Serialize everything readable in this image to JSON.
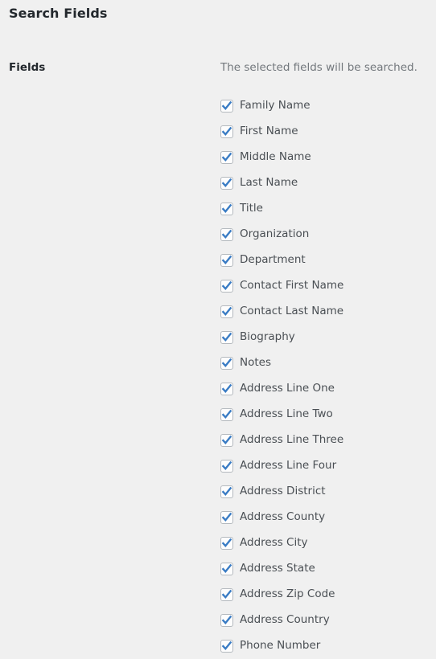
{
  "page": {
    "title": "Search Fields",
    "background_color": "#f0f0f0"
  },
  "fields_section": {
    "label": "Fields",
    "description": "The selected fields will be searched.",
    "checkbox_check_color": "#3a7cc4",
    "checkbox_border_color": "#b4b9be",
    "checkbox_fill_color": "#fdfdfd",
    "items": [
      {
        "label": "Family Name",
        "checked": true
      },
      {
        "label": "First Name",
        "checked": true
      },
      {
        "label": "Middle Name",
        "checked": true
      },
      {
        "label": "Last Name",
        "checked": true
      },
      {
        "label": "Title",
        "checked": true
      },
      {
        "label": "Organization",
        "checked": true
      },
      {
        "label": "Department",
        "checked": true
      },
      {
        "label": "Contact First Name",
        "checked": true
      },
      {
        "label": "Contact Last Name",
        "checked": true
      },
      {
        "label": "Biography",
        "checked": true
      },
      {
        "label": "Notes",
        "checked": true
      },
      {
        "label": "Address Line One",
        "checked": true
      },
      {
        "label": "Address Line Two",
        "checked": true
      },
      {
        "label": "Address Line Three",
        "checked": true
      },
      {
        "label": "Address Line Four",
        "checked": true
      },
      {
        "label": "Address District",
        "checked": true
      },
      {
        "label": "Address County",
        "checked": true
      },
      {
        "label": "Address City",
        "checked": true
      },
      {
        "label": "Address State",
        "checked": true
      },
      {
        "label": "Address Zip Code",
        "checked": true
      },
      {
        "label": "Address Country",
        "checked": true
      },
      {
        "label": "Phone Number",
        "checked": true
      }
    ]
  }
}
